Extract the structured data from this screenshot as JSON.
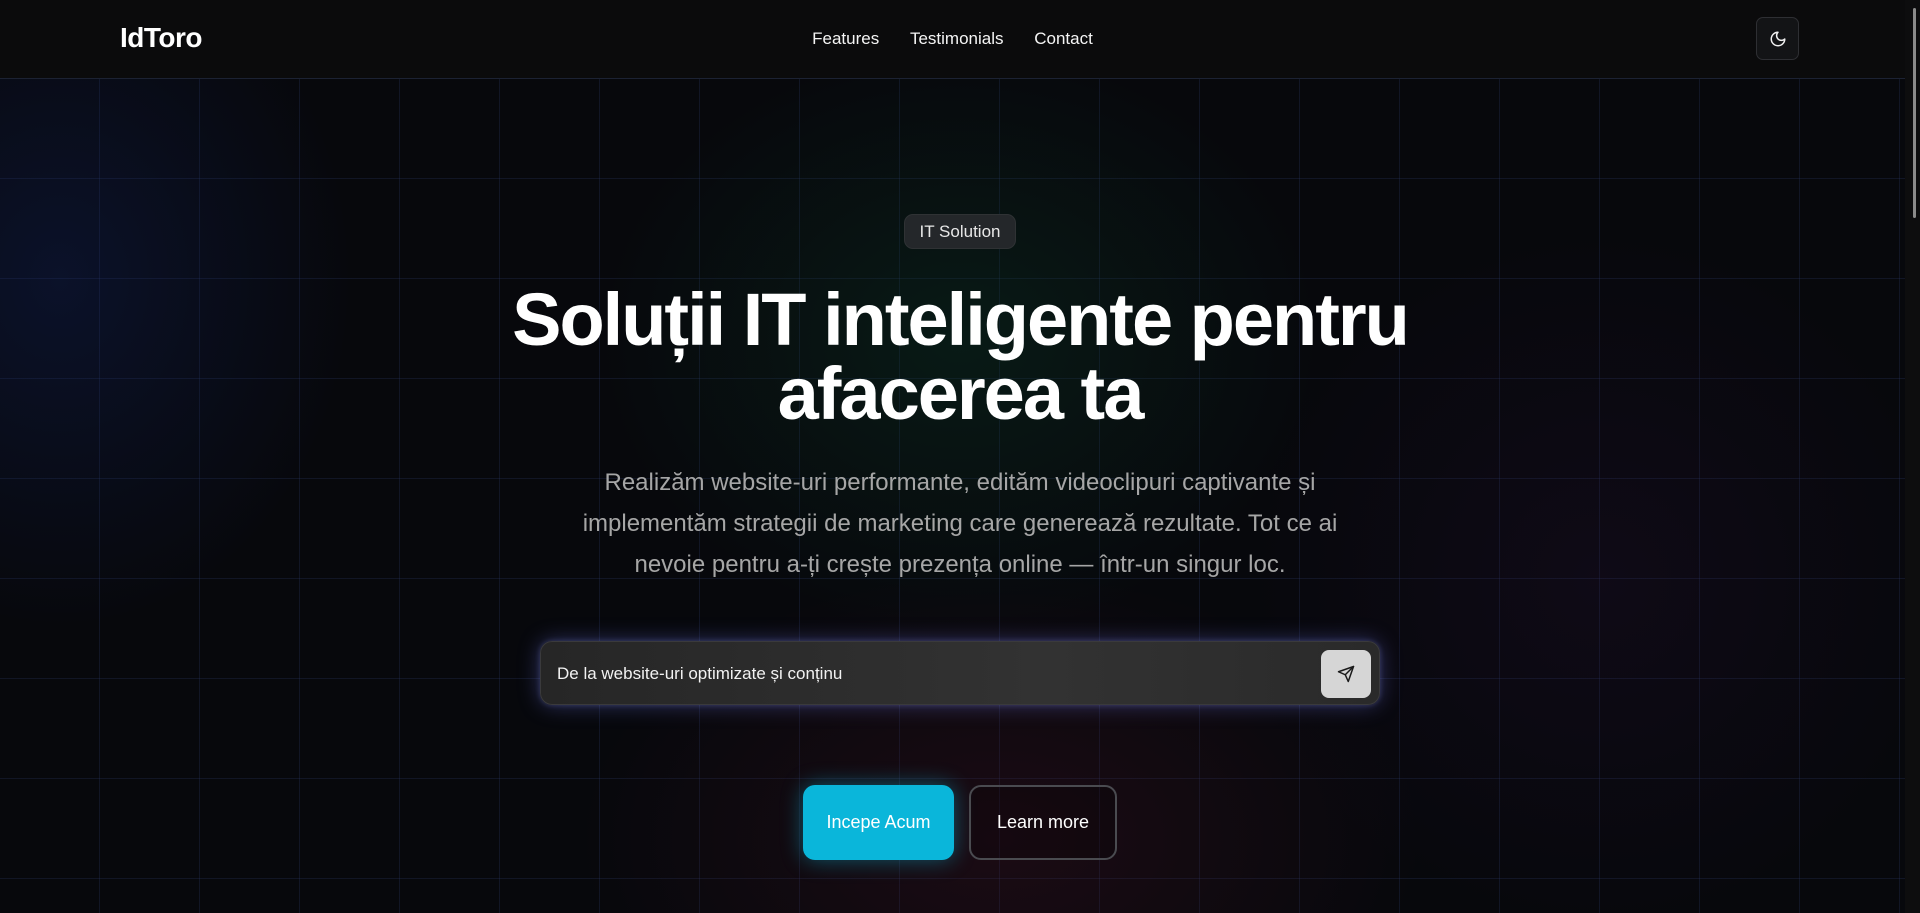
{
  "navbar": {
    "logo": "IdToro",
    "links": [
      "Features",
      "Testimonials",
      "Contact"
    ],
    "theme_toggle_icon": "moon-icon"
  },
  "hero": {
    "badge": "IT Solution",
    "title_line1": "Soluții IT inteligente pentru",
    "title_line2": "afacerea ta",
    "subtitle_line1": "Realizăm website-uri performante, edităm videoclipuri captivante și",
    "subtitle_line2": "implementăm strategii de marketing care generează rezultate. Tot ce ai",
    "subtitle_line3": "nevoie pentru a-ți crește prezența online — într-un singur loc.",
    "prompt": {
      "value": "De la website-uri optimizate și conținu",
      "send_icon": "send-icon"
    },
    "primary_button": "Incepe Acum",
    "secondary_button": "Learn more"
  },
  "colors": {
    "accent": "#0ab6da",
    "background": "#07080b",
    "text": "#ffffff",
    "muted_text": "#a6a6a6"
  }
}
